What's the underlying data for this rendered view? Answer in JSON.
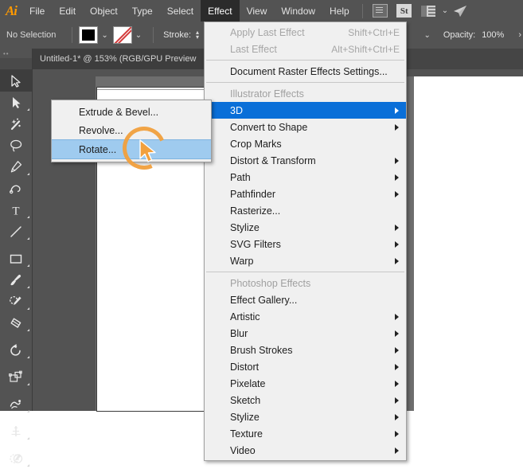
{
  "app": {
    "name": "Adobe Illustrator",
    "logo_text": "Ai",
    "accent_color": "#ff9a00",
    "chrome_color": "#535353",
    "menu_highlight_color": "#0a6fd8",
    "submenu_highlight_color": "#9fcbef",
    "cursor_color": "#f2a03d"
  },
  "menubar": {
    "items": [
      {
        "label": "File",
        "active": false
      },
      {
        "label": "Edit",
        "active": false
      },
      {
        "label": "Object",
        "active": false
      },
      {
        "label": "Type",
        "active": false
      },
      {
        "label": "Select",
        "active": false
      },
      {
        "label": "Effect",
        "active": true
      },
      {
        "label": "View",
        "active": false
      },
      {
        "label": "Window",
        "active": false
      },
      {
        "label": "Help",
        "active": false
      }
    ],
    "icons": [
      {
        "name": "document-setup-icon"
      },
      {
        "name": "stock-st-icon",
        "label": "St"
      },
      {
        "name": "arrange-documents-icon"
      },
      {
        "name": "chevron-down-icon",
        "glyph": "⌄"
      },
      {
        "name": "rocket-icon",
        "glyph": "✈"
      }
    ]
  },
  "controlbar": {
    "selection_status": "No Selection",
    "fill_swatch_label": "Fill color",
    "stroke_swatch_label": "Stroke color",
    "fill_dropdown_glyph": "⌄",
    "stroke_dropdown_glyph": "⌄",
    "stroke_label": "Stroke:",
    "stepper_up": "▴",
    "stepper_down": "▾",
    "brush_dropdown_glyph": "⌄",
    "opacity_label": "Opacity:",
    "opacity_value": "100%",
    "opacity_more_glyph": "›"
  },
  "document": {
    "tab_title": "Untitled-1* @ 153% (RGB/GPU Preview"
  },
  "toolbar": {
    "grip": "••",
    "tools": [
      {
        "name": "selection-tool",
        "glyph": "selection",
        "selected": true,
        "has_flyout": false
      },
      {
        "name": "direct-selection-tool",
        "glyph": "direct-selection",
        "selected": false,
        "has_flyout": true
      },
      {
        "name": "magic-wand-tool",
        "glyph": "magic-wand",
        "selected": false,
        "has_flyout": false
      },
      {
        "name": "lasso-tool",
        "glyph": "lasso",
        "selected": false,
        "has_flyout": false
      },
      {
        "name": "pen-tool",
        "glyph": "pen",
        "selected": false,
        "has_flyout": true
      },
      {
        "name": "curvature-tool",
        "glyph": "curvature",
        "selected": false,
        "has_flyout": false
      },
      {
        "name": "type-tool",
        "glyph": "type",
        "selected": false,
        "has_flyout": true
      },
      {
        "name": "line-segment-tool",
        "glyph": "line",
        "selected": false,
        "has_flyout": true
      },
      {
        "name": "rectangle-tool",
        "glyph": "rectangle",
        "selected": false,
        "has_flyout": true
      },
      {
        "name": "paintbrush-tool",
        "glyph": "paintbrush",
        "selected": false,
        "has_flyout": true
      },
      {
        "name": "shaper-pencil-tool",
        "glyph": "pencil",
        "selected": false,
        "has_flyout": true
      },
      {
        "name": "eraser-tool",
        "glyph": "eraser",
        "selected": false,
        "has_flyout": true
      },
      {
        "name": "rotate-tool",
        "glyph": "rotate",
        "selected": false,
        "has_flyout": true
      },
      {
        "name": "scale-shear-tool",
        "glyph": "scale",
        "selected": false,
        "has_flyout": true
      },
      {
        "name": "width-warp-tool",
        "glyph": "warp",
        "selected": false,
        "has_flyout": true
      },
      {
        "name": "free-transform-tool",
        "glyph": "free-transform",
        "selected": false,
        "has_flyout": true
      },
      {
        "name": "shape-builder-tool",
        "glyph": "shape-builder",
        "selected": false,
        "has_flyout": true
      }
    ]
  },
  "effect_menu": {
    "rows": [
      {
        "type": "item",
        "label": "Apply Last Effect",
        "shortcut": "Shift+Ctrl+E",
        "disabled": true,
        "submenu": false,
        "highlight": false
      },
      {
        "type": "item",
        "label": "Last Effect",
        "shortcut": "Alt+Shift+Ctrl+E",
        "disabled": true,
        "submenu": false,
        "highlight": false
      },
      {
        "type": "separator"
      },
      {
        "type": "item",
        "label": "Document Raster Effects Settings...",
        "shortcut": "",
        "disabled": false,
        "submenu": false,
        "highlight": false
      },
      {
        "type": "separator"
      },
      {
        "type": "section",
        "label": "Illustrator Effects"
      },
      {
        "type": "item",
        "label": "3D",
        "shortcut": "",
        "disabled": false,
        "submenu": true,
        "highlight": true
      },
      {
        "type": "item",
        "label": "Convert to Shape",
        "shortcut": "",
        "disabled": false,
        "submenu": true,
        "highlight": false
      },
      {
        "type": "item",
        "label": "Crop Marks",
        "shortcut": "",
        "disabled": false,
        "submenu": false,
        "highlight": false
      },
      {
        "type": "item",
        "label": "Distort & Transform",
        "shortcut": "",
        "disabled": false,
        "submenu": true,
        "highlight": false
      },
      {
        "type": "item",
        "label": "Path",
        "shortcut": "",
        "disabled": false,
        "submenu": true,
        "highlight": false
      },
      {
        "type": "item",
        "label": "Pathfinder",
        "shortcut": "",
        "disabled": false,
        "submenu": true,
        "highlight": false
      },
      {
        "type": "item",
        "label": "Rasterize...",
        "shortcut": "",
        "disabled": false,
        "submenu": false,
        "highlight": false
      },
      {
        "type": "item",
        "label": "Stylize",
        "shortcut": "",
        "disabled": false,
        "submenu": true,
        "highlight": false
      },
      {
        "type": "item",
        "label": "SVG Filters",
        "shortcut": "",
        "disabled": false,
        "submenu": true,
        "highlight": false
      },
      {
        "type": "item",
        "label": "Warp",
        "shortcut": "",
        "disabled": false,
        "submenu": true,
        "highlight": false
      },
      {
        "type": "separator"
      },
      {
        "type": "section",
        "label": "Photoshop Effects"
      },
      {
        "type": "item",
        "label": "Effect Gallery...",
        "shortcut": "",
        "disabled": false,
        "submenu": false,
        "highlight": false
      },
      {
        "type": "item",
        "label": "Artistic",
        "shortcut": "",
        "disabled": false,
        "submenu": true,
        "highlight": false
      },
      {
        "type": "item",
        "label": "Blur",
        "shortcut": "",
        "disabled": false,
        "submenu": true,
        "highlight": false
      },
      {
        "type": "item",
        "label": "Brush Strokes",
        "shortcut": "",
        "disabled": false,
        "submenu": true,
        "highlight": false
      },
      {
        "type": "item",
        "label": "Distort",
        "shortcut": "",
        "disabled": false,
        "submenu": true,
        "highlight": false
      },
      {
        "type": "item",
        "label": "Pixelate",
        "shortcut": "",
        "disabled": false,
        "submenu": true,
        "highlight": false
      },
      {
        "type": "item",
        "label": "Sketch",
        "shortcut": "",
        "disabled": false,
        "submenu": true,
        "highlight": false
      },
      {
        "type": "item",
        "label": "Stylize",
        "shortcut": "",
        "disabled": false,
        "submenu": true,
        "highlight": false
      },
      {
        "type": "item",
        "label": "Texture",
        "shortcut": "",
        "disabled": false,
        "submenu": true,
        "highlight": false
      },
      {
        "type": "item",
        "label": "Video",
        "shortcut": "",
        "disabled": false,
        "submenu": true,
        "highlight": false
      }
    ]
  },
  "submenu_3d": {
    "rows": [
      {
        "label": "Extrude & Bevel...",
        "highlight": false
      },
      {
        "label": "Revolve...",
        "highlight": false
      },
      {
        "label": "Rotate...",
        "highlight": true
      }
    ]
  },
  "cursor": {
    "name": "mouse-pointer",
    "click_highlight": true
  }
}
